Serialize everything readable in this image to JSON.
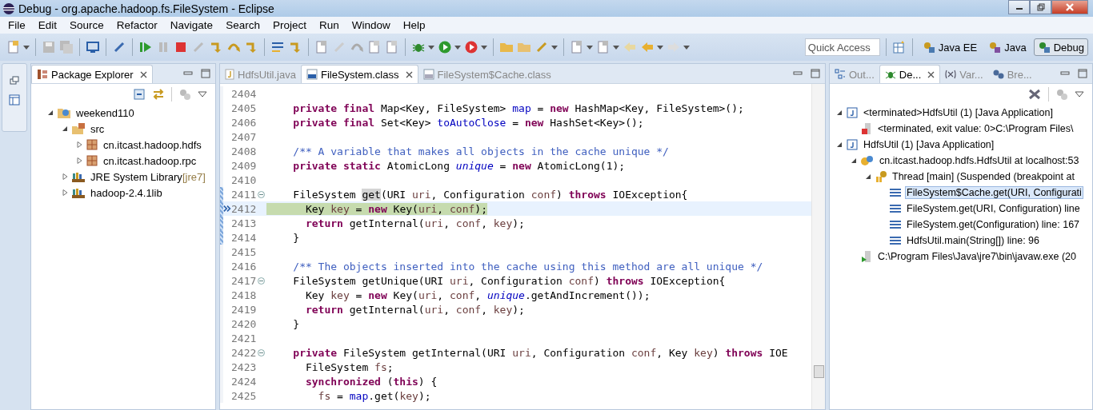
{
  "window": {
    "title": "Debug - org.apache.hadoop.fs.FileSystem - Eclipse"
  },
  "menu": [
    "File",
    "Edit",
    "Source",
    "Refactor",
    "Navigate",
    "Search",
    "Project",
    "Run",
    "Window",
    "Help"
  ],
  "quick_access": {
    "placeholder": "Quick Access"
  },
  "perspectives": [
    {
      "label": "Java EE",
      "selected": false
    },
    {
      "label": "Java",
      "selected": false
    },
    {
      "label": "Debug",
      "selected": true
    }
  ],
  "package_explorer": {
    "title": "Package Explorer",
    "tree": [
      {
        "label": "weekend110",
        "kind": "project",
        "expanded": true,
        "children": [
          {
            "label": "src",
            "kind": "source-folder",
            "expanded": true,
            "children": [
              {
                "label": "cn.itcast.hadoop.hdfs",
                "kind": "package",
                "expanded": false
              },
              {
                "label": "cn.itcast.hadoop.rpc",
                "kind": "package",
                "expanded": false
              }
            ]
          },
          {
            "label": "JRE System Library",
            "decoration": "[jre7]",
            "kind": "library",
            "expanded": false
          },
          {
            "label": "hadoop-2.4.1lib",
            "kind": "library",
            "expanded": false
          }
        ]
      }
    ]
  },
  "editor_tabs": [
    {
      "label": "HdfsUtil.java",
      "kind": "java",
      "selected": false
    },
    {
      "label": "FileSystem.class",
      "kind": "class",
      "selected": true
    },
    {
      "label": "FileSystem$Cache.class",
      "kind": "class",
      "selected": false
    }
  ],
  "code": [
    {
      "num": "2404",
      "current": false,
      "marked": false,
      "foldable": false
    },
    {
      "num": "2405",
      "current": false,
      "marked": false,
      "foldable": false,
      "tokens": [
        {
          "kind": "kw",
          "text": "    private"
        },
        {
          "kind": "kw",
          "text": " final"
        },
        {
          "kind": "plain",
          "text": " Map<Key, FileSystem> "
        },
        {
          "kind": "field",
          "text": "map"
        },
        {
          "kind": "plain",
          "text": " = "
        },
        {
          "kind": "kw",
          "text": "new"
        },
        {
          "kind": "plain",
          "text": " HashMap<Key, FileSystem>();"
        }
      ]
    },
    {
      "num": "2406",
      "current": false,
      "marked": false,
      "foldable": false,
      "tokens": [
        {
          "kind": "kw",
          "text": "    private"
        },
        {
          "kind": "kw",
          "text": " final"
        },
        {
          "kind": "plain",
          "text": " Set<Key> "
        },
        {
          "kind": "field",
          "text": "toAutoClose"
        },
        {
          "kind": "plain",
          "text": " = "
        },
        {
          "kind": "kw",
          "text": "new"
        },
        {
          "kind": "plain",
          "text": " HashSet<Key>();"
        }
      ]
    },
    {
      "num": "2407",
      "current": false,
      "marked": false,
      "foldable": false
    },
    {
      "num": "2408",
      "current": false,
      "marked": false,
      "foldable": false,
      "tokens": [
        {
          "kind": "comment",
          "text": "    /** A variable that makes all objects in the cache unique */"
        }
      ]
    },
    {
      "num": "2409",
      "current": false,
      "marked": false,
      "foldable": false,
      "tokens": [
        {
          "kind": "kw",
          "text": "    private"
        },
        {
          "kind": "kw",
          "text": " static"
        },
        {
          "kind": "plain",
          "text": " AtomicLong "
        },
        {
          "kind": "static",
          "text": "unique"
        },
        {
          "kind": "plain",
          "text": " = "
        },
        {
          "kind": "kw",
          "text": "new"
        },
        {
          "kind": "plain",
          "text": " AtomicLong(1);"
        }
      ]
    },
    {
      "num": "2410",
      "current": false,
      "marked": false,
      "foldable": false
    },
    {
      "num": "2411",
      "current": false,
      "marked": true,
      "foldable": true,
      "tokens": [
        {
          "kind": "plain",
          "text": "    FileSystem "
        },
        {
          "kind": "occurrence",
          "text": "get"
        },
        {
          "kind": "plain",
          "text": "(URI "
        },
        {
          "kind": "var",
          "text": "uri"
        },
        {
          "kind": "plain",
          "text": ", Configuration "
        },
        {
          "kind": "var",
          "text": "conf"
        },
        {
          "kind": "plain",
          "text": ") "
        },
        {
          "kind": "kw",
          "text": "throws"
        },
        {
          "kind": "plain",
          "text": " IOException{"
        }
      ]
    },
    {
      "num": "2412",
      "current": true,
      "marked": true,
      "foldable": false,
      "tokens": [
        {
          "kind": "plain",
          "text": "      Key "
        },
        {
          "kind": "var",
          "text": "key"
        },
        {
          "kind": "plain",
          "text": " = "
        },
        {
          "kind": "kw",
          "text": "new"
        },
        {
          "kind": "plain",
          "text": " Key("
        },
        {
          "kind": "var",
          "text": "uri"
        },
        {
          "kind": "plain",
          "text": ", "
        },
        {
          "kind": "var",
          "text": "conf"
        },
        {
          "kind": "plain",
          "text": ");"
        }
      ]
    },
    {
      "num": "2413",
      "current": false,
      "marked": true,
      "foldable": false,
      "tokens": [
        {
          "kind": "kw",
          "text": "      return"
        },
        {
          "kind": "plain",
          "text": " getInternal("
        },
        {
          "kind": "var",
          "text": "uri"
        },
        {
          "kind": "plain",
          "text": ", "
        },
        {
          "kind": "var",
          "text": "conf"
        },
        {
          "kind": "plain",
          "text": ", "
        },
        {
          "kind": "var",
          "text": "key"
        },
        {
          "kind": "plain",
          "text": ");"
        }
      ]
    },
    {
      "num": "2414",
      "current": false,
      "marked": true,
      "foldable": false,
      "tokens": [
        {
          "kind": "plain",
          "text": "    }"
        }
      ]
    },
    {
      "num": "2415",
      "current": false,
      "marked": false,
      "foldable": false
    },
    {
      "num": "2416",
      "current": false,
      "marked": false,
      "foldable": false,
      "tokens": [
        {
          "kind": "comment",
          "text": "    /** The objects inserted into the cache using this method are all unique */"
        }
      ]
    },
    {
      "num": "2417",
      "current": false,
      "marked": false,
      "foldable": true,
      "tokens": [
        {
          "kind": "plain",
          "text": "    FileSystem getUnique(URI "
        },
        {
          "kind": "var",
          "text": "uri"
        },
        {
          "kind": "plain",
          "text": ", Configuration "
        },
        {
          "kind": "var",
          "text": "conf"
        },
        {
          "kind": "plain",
          "text": ") "
        },
        {
          "kind": "kw",
          "text": "throws"
        },
        {
          "kind": "plain",
          "text": " IOException{"
        }
      ]
    },
    {
      "num": "2418",
      "current": false,
      "marked": false,
      "foldable": false,
      "tokens": [
        {
          "kind": "plain",
          "text": "      Key "
        },
        {
          "kind": "var",
          "text": "key"
        },
        {
          "kind": "plain",
          "text": " = "
        },
        {
          "kind": "kw",
          "text": "new"
        },
        {
          "kind": "plain",
          "text": " Key("
        },
        {
          "kind": "var",
          "text": "uri"
        },
        {
          "kind": "plain",
          "text": ", "
        },
        {
          "kind": "var",
          "text": "conf"
        },
        {
          "kind": "plain",
          "text": ", "
        },
        {
          "kind": "static",
          "text": "unique"
        },
        {
          "kind": "plain",
          "text": ".getAndIncrement());"
        }
      ]
    },
    {
      "num": "2419",
      "current": false,
      "marked": false,
      "foldable": false,
      "tokens": [
        {
          "kind": "kw",
          "text": "      return"
        },
        {
          "kind": "plain",
          "text": " getInternal("
        },
        {
          "kind": "var",
          "text": "uri"
        },
        {
          "kind": "plain",
          "text": ", "
        },
        {
          "kind": "var",
          "text": "conf"
        },
        {
          "kind": "plain",
          "text": ", "
        },
        {
          "kind": "var",
          "text": "key"
        },
        {
          "kind": "plain",
          "text": ");"
        }
      ]
    },
    {
      "num": "2420",
      "current": false,
      "marked": false,
      "foldable": false,
      "tokens": [
        {
          "kind": "plain",
          "text": "    }"
        }
      ]
    },
    {
      "num": "2421",
      "current": false,
      "marked": false,
      "foldable": false
    },
    {
      "num": "2422",
      "current": false,
      "marked": false,
      "foldable": true,
      "tokens": [
        {
          "kind": "kw",
          "text": "    private"
        },
        {
          "kind": "plain",
          "text": " FileSystem getInternal(URI "
        },
        {
          "kind": "var",
          "text": "uri"
        },
        {
          "kind": "plain",
          "text": ", Configuration "
        },
        {
          "kind": "var",
          "text": "conf"
        },
        {
          "kind": "plain",
          "text": ", Key "
        },
        {
          "kind": "var",
          "text": "key"
        },
        {
          "kind": "plain",
          "text": ") "
        },
        {
          "kind": "kw",
          "text": "throws"
        },
        {
          "kind": "plain",
          "text": " IOE"
        }
      ]
    },
    {
      "num": "2423",
      "current": false,
      "marked": false,
      "foldable": false,
      "tokens": [
        {
          "kind": "plain",
          "text": "      FileSystem "
        },
        {
          "kind": "var",
          "text": "fs"
        },
        {
          "kind": "plain",
          "text": ";"
        }
      ]
    },
    {
      "num": "2424",
      "current": false,
      "marked": false,
      "foldable": false,
      "tokens": [
        {
          "kind": "kw",
          "text": "      synchronized"
        },
        {
          "kind": "plain",
          "text": " ("
        },
        {
          "kind": "kw",
          "text": "this"
        },
        {
          "kind": "plain",
          "text": ") {"
        }
      ]
    },
    {
      "num": "2425",
      "current": false,
      "marked": false,
      "foldable": false,
      "tokens": [
        {
          "kind": "var",
          "text": "        fs"
        },
        {
          "kind": "plain",
          "text": " = "
        },
        {
          "kind": "field",
          "text": "map"
        },
        {
          "kind": "plain",
          "text": ".get("
        },
        {
          "kind": "var",
          "text": "key"
        },
        {
          "kind": "plain",
          "text": ");"
        }
      ]
    }
  ],
  "right_tabs": [
    {
      "label": "Out...",
      "kind": "outline",
      "selected": false
    },
    {
      "label": "De...",
      "kind": "debug",
      "selected": true
    },
    {
      "label": "Var...",
      "kind": "variables",
      "selected": false
    },
    {
      "label": "Bre...",
      "kind": "breakpoints",
      "selected": false
    }
  ],
  "debug_tree": [
    {
      "label": "<terminated>HdfsUtil (1) [Java Application]",
      "kind": "launch",
      "expanded": true,
      "selected": false,
      "children": [
        {
          "label": "<terminated, exit value: 0>C:\\Program Files\\",
          "kind": "terminated-process",
          "selected": false
        }
      ]
    },
    {
      "label": "HdfsUtil (1) [Java Application]",
      "kind": "launch",
      "expanded": true,
      "selected": false,
      "children": [
        {
          "label": "cn.itcast.hadoop.hdfs.HdfsUtil at localhost:53",
          "kind": "target",
          "expanded": true,
          "selected": false,
          "children": [
            {
              "label": "Thread [main] (Suspended (breakpoint at",
              "kind": "thread",
              "expanded": true,
              "selected": false,
              "children": [
                {
                  "label": "FileSystem$Cache.get(URI, Configurati",
                  "kind": "frame",
                  "selected": true
                },
                {
                  "label": "FileSystem.get(URI, Configuration) line",
                  "kind": "frame",
                  "selected": false
                },
                {
                  "label": "FileSystem.get(Configuration) line: 167",
                  "kind": "frame",
                  "selected": false
                },
                {
                  "label": "HdfsUtil.main(String[]) line: 96",
                  "kind": "frame",
                  "selected": false
                }
              ]
            }
          ]
        },
        {
          "label": "C:\\Program Files\\Java\\jre7\\bin\\javaw.exe (20",
          "kind": "process",
          "selected": false
        }
      ]
    }
  ]
}
